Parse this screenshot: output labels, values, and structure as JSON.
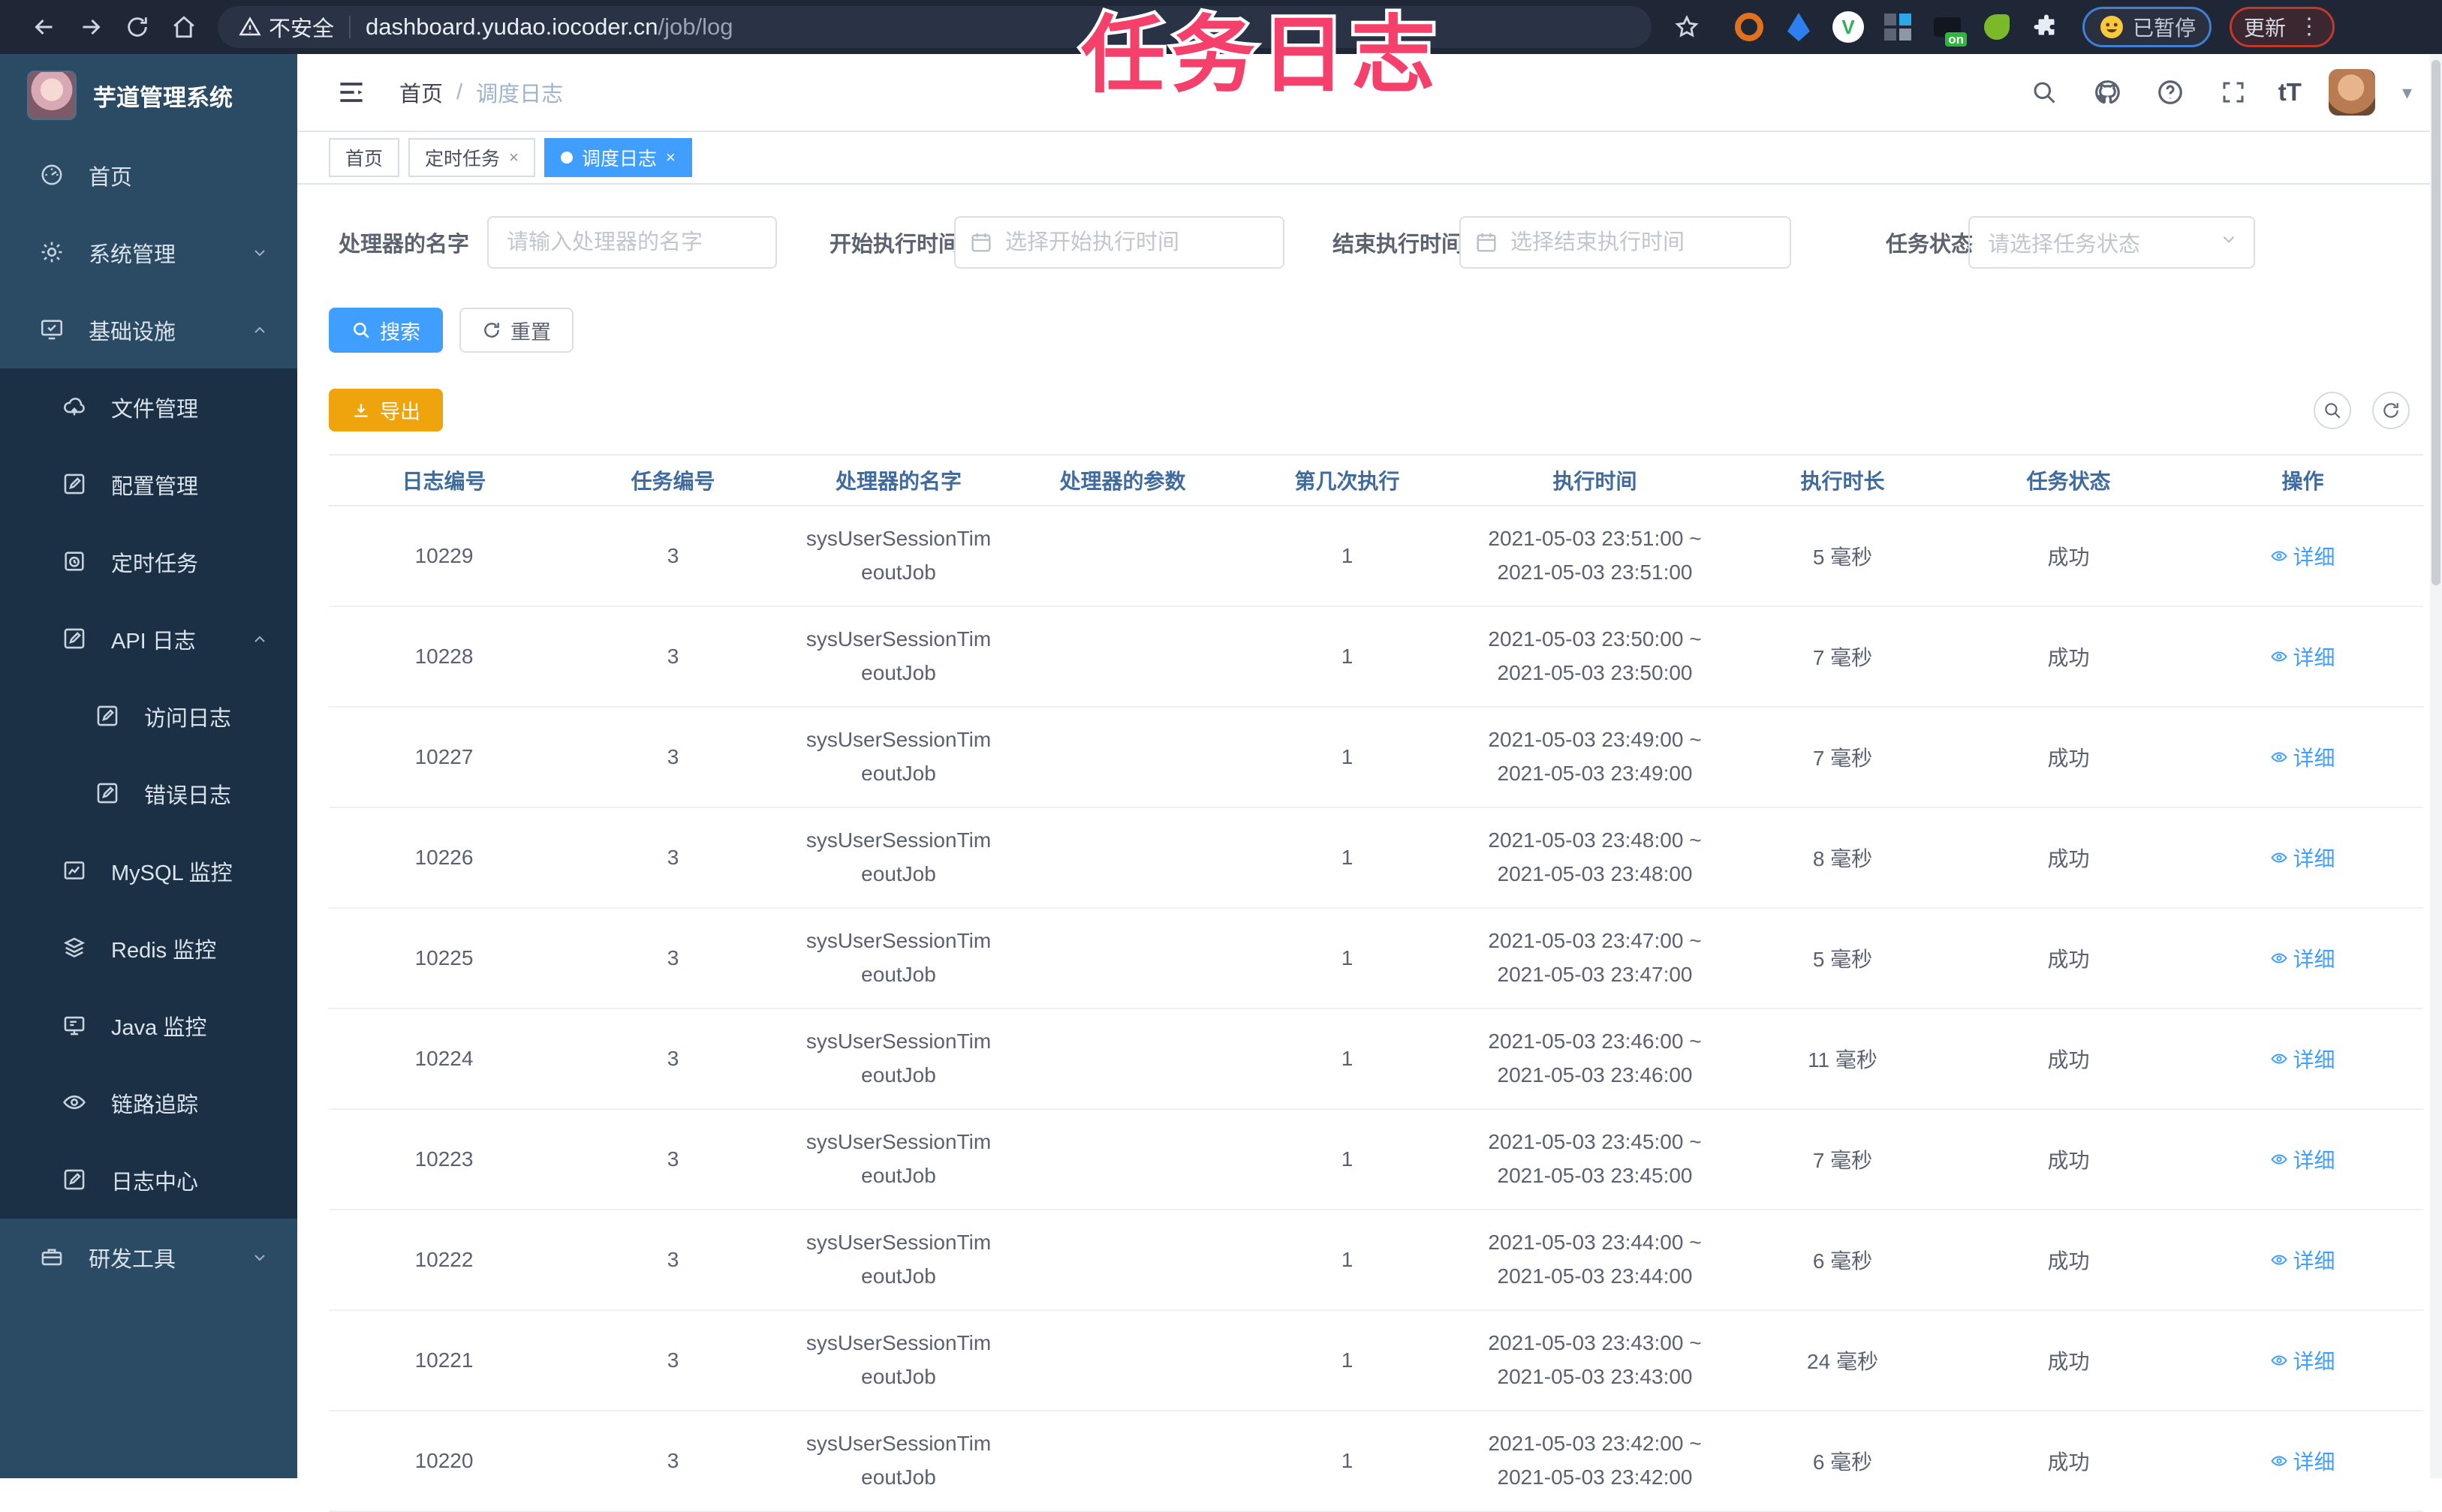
{
  "watermark": "任务日志",
  "browser": {
    "insecure_label": "不安全",
    "url_host": "dashboard.yudao.iocoder.cn",
    "url_path": "/job/log",
    "extension_badge": "on",
    "paused_badge": "已暂停",
    "update_label": "更新"
  },
  "sidebar": {
    "app_title": "芋道管理系统",
    "menu": {
      "home": "首页",
      "system": "系统管理",
      "infra": "基础设施",
      "file": "文件管理",
      "config": "配置管理",
      "job": "定时任务",
      "api_log": "API 日志",
      "access_log": "访问日志",
      "error_log": "错误日志",
      "mysql": "MySQL 监控",
      "redis": "Redis 监控",
      "java": "Java 监控",
      "trace": "链路追踪",
      "log_center": "日志中心",
      "dev_tools": "研发工具"
    }
  },
  "header": {
    "breadcrumb_home": "首页",
    "breadcrumb_sep": "/",
    "breadcrumb_current": "调度日志",
    "font_size_label": "tT"
  },
  "tabs": {
    "home": "首页",
    "job": "定时任务",
    "job_log": "调度日志"
  },
  "filters": {
    "handler_label": "处理器的名字",
    "handler_placeholder": "请输入处理器的名字",
    "begin_label": "开始执行时间",
    "begin_placeholder": "选择开始执行时间",
    "end_label": "结束执行时间",
    "end_placeholder": "选择结束执行时间",
    "status_label": "任务状态",
    "status_placeholder": "请选择任务状态"
  },
  "actions": {
    "search": "搜索",
    "reset": "重置",
    "export": "导出"
  },
  "table": {
    "columns": [
      "日志编号",
      "任务编号",
      "处理器的名字",
      "处理器的参数",
      "第几次执行",
      "执行时间",
      "执行时长",
      "任务状态",
      "操作"
    ],
    "detail_label": "详细",
    "rows": [
      {
        "log_id": "10229",
        "job_id": "3",
        "handler_l1": "sysUserSessionTim",
        "handler_l2": "eoutJob",
        "param": "",
        "count": "1",
        "time_l1": "2021-05-03 23:51:00 ~",
        "time_l2": "2021-05-03 23:51:00",
        "duration": "5 毫秒",
        "status": "成功"
      },
      {
        "log_id": "10228",
        "job_id": "3",
        "handler_l1": "sysUserSessionTim",
        "handler_l2": "eoutJob",
        "param": "",
        "count": "1",
        "time_l1": "2021-05-03 23:50:00 ~",
        "time_l2": "2021-05-03 23:50:00",
        "duration": "7 毫秒",
        "status": "成功"
      },
      {
        "log_id": "10227",
        "job_id": "3",
        "handler_l1": "sysUserSessionTim",
        "handler_l2": "eoutJob",
        "param": "",
        "count": "1",
        "time_l1": "2021-05-03 23:49:00 ~",
        "time_l2": "2021-05-03 23:49:00",
        "duration": "7 毫秒",
        "status": "成功"
      },
      {
        "log_id": "10226",
        "job_id": "3",
        "handler_l1": "sysUserSessionTim",
        "handler_l2": "eoutJob",
        "param": "",
        "count": "1",
        "time_l1": "2021-05-03 23:48:00 ~",
        "time_l2": "2021-05-03 23:48:00",
        "duration": "8 毫秒",
        "status": "成功"
      },
      {
        "log_id": "10225",
        "job_id": "3",
        "handler_l1": "sysUserSessionTim",
        "handler_l2": "eoutJob",
        "param": "",
        "count": "1",
        "time_l1": "2021-05-03 23:47:00 ~",
        "time_l2": "2021-05-03 23:47:00",
        "duration": "5 毫秒",
        "status": "成功"
      },
      {
        "log_id": "10224",
        "job_id": "3",
        "handler_l1": "sysUserSessionTim",
        "handler_l2": "eoutJob",
        "param": "",
        "count": "1",
        "time_l1": "2021-05-03 23:46:00 ~",
        "time_l2": "2021-05-03 23:46:00",
        "duration": "11 毫秒",
        "status": "成功"
      },
      {
        "log_id": "10223",
        "job_id": "3",
        "handler_l1": "sysUserSessionTim",
        "handler_l2": "eoutJob",
        "param": "",
        "count": "1",
        "time_l1": "2021-05-03 23:45:00 ~",
        "time_l2": "2021-05-03 23:45:00",
        "duration": "7 毫秒",
        "status": "成功"
      },
      {
        "log_id": "10222",
        "job_id": "3",
        "handler_l1": "sysUserSessionTim",
        "handler_l2": "eoutJob",
        "param": "",
        "count": "1",
        "time_l1": "2021-05-03 23:44:00 ~",
        "time_l2": "2021-05-03 23:44:00",
        "duration": "6 毫秒",
        "status": "成功"
      },
      {
        "log_id": "10221",
        "job_id": "3",
        "handler_l1": "sysUserSessionTim",
        "handler_l2": "eoutJob",
        "param": "",
        "count": "1",
        "time_l1": "2021-05-03 23:43:00 ~",
        "time_l2": "2021-05-03 23:43:00",
        "duration": "24 毫秒",
        "status": "成功"
      },
      {
        "log_id": "10220",
        "job_id": "3",
        "handler_l1": "sysUserSessionTim",
        "handler_l2": "eoutJob",
        "param": "",
        "count": "1",
        "time_l1": "2021-05-03 23:42:00 ~",
        "time_l2": "2021-05-03 23:42:00",
        "duration": "6 毫秒",
        "status": "成功"
      }
    ]
  }
}
